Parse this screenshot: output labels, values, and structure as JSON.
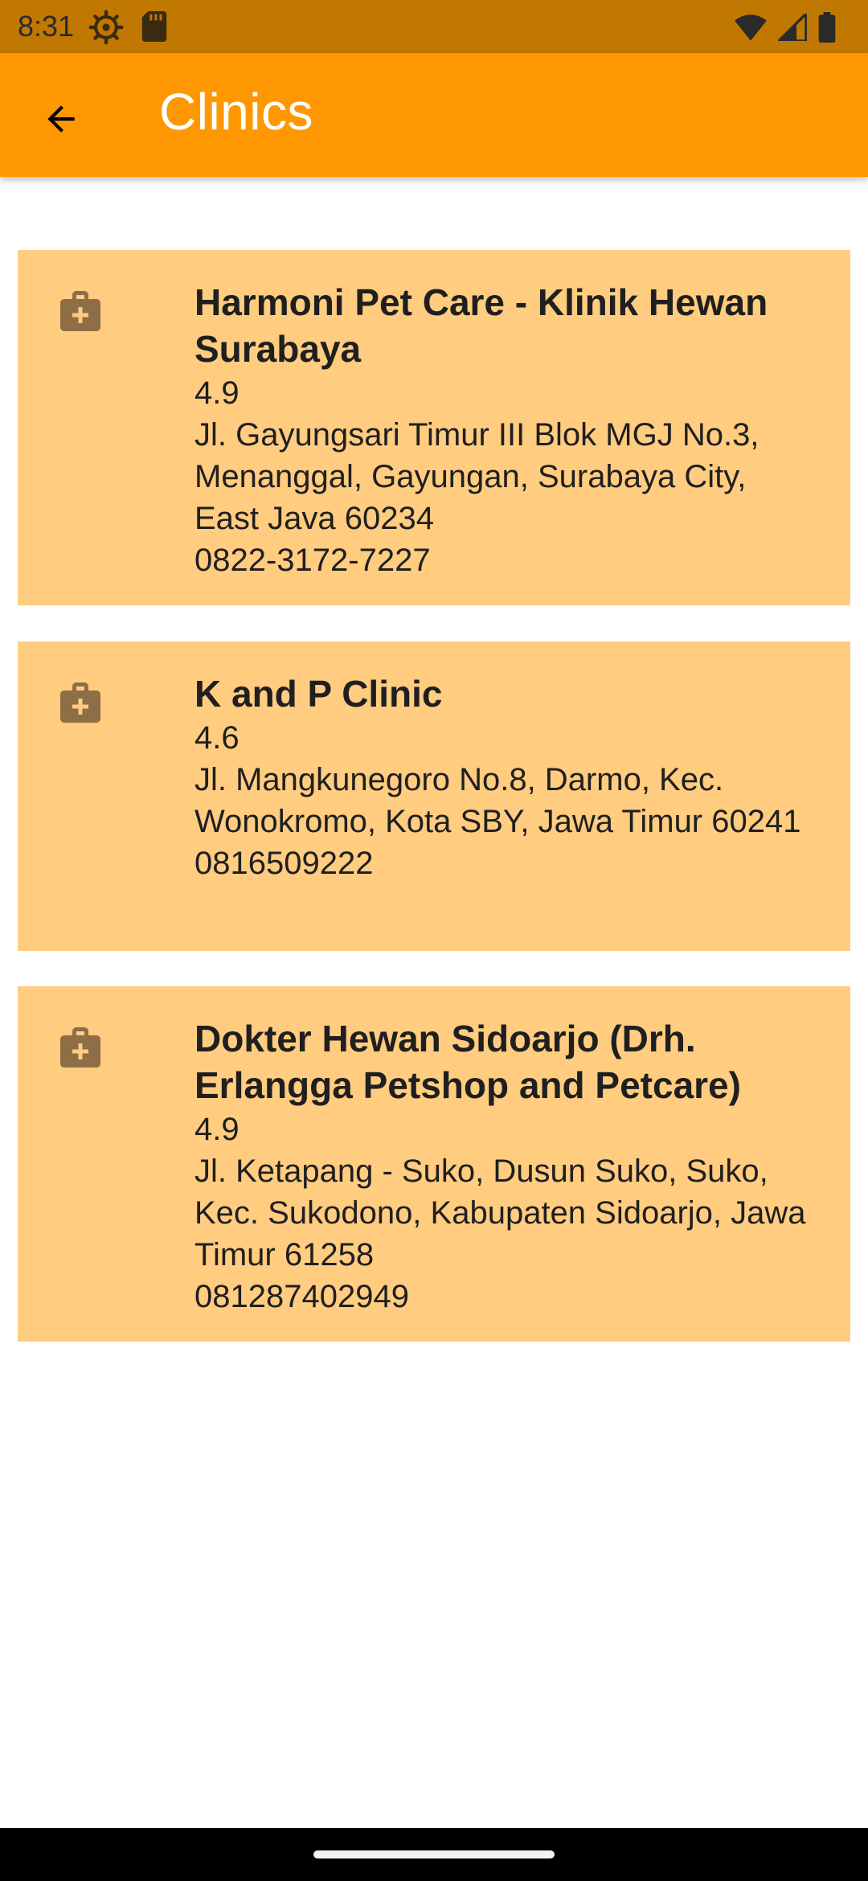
{
  "status_bar": {
    "time": "8:31",
    "icons": [
      "settings-gear-icon",
      "sd-card-icon",
      "wifi-icon",
      "cell-signal-icon",
      "battery-icon"
    ]
  },
  "app_bar": {
    "title": "Clinics",
    "back_icon": "arrow-left-icon",
    "background_color": "#ff9800"
  },
  "clinics": [
    {
      "name": "Harmoni Pet Care - Klinik Hewan Surabaya",
      "rating": "4.9",
      "address": "Jl. Gayungsari Timur III Blok MGJ No.3, Menanggal, Gayungan, Surabaya City, East Java 60234",
      "phone": "0822-3172-7227",
      "icon": "medical-bag-icon"
    },
    {
      "name": "K and P Clinic",
      "rating": "4.6",
      "address": "Jl. Mangkunegoro No.8, Darmo, Kec. Wonokromo, Kota SBY, Jawa Timur 60241",
      "phone": "0816509222",
      "icon": "medical-bag-icon"
    },
    {
      "name": "Dokter Hewan Sidoarjo (Drh. Erlangga Petshop and Petcare)",
      "rating": "4.9",
      "address": "Jl. Ketapang - Suko, Dusun Suko, Suko, Kec. Sukodono, Kabupaten Sidoarjo, Jawa Timur 61258",
      "phone": "081287402949",
      "icon": "medical-bag-icon"
    }
  ],
  "colors": {
    "status_bar": "#c17800",
    "card_background": "#ffcc80",
    "icon": "#8d6e47"
  }
}
